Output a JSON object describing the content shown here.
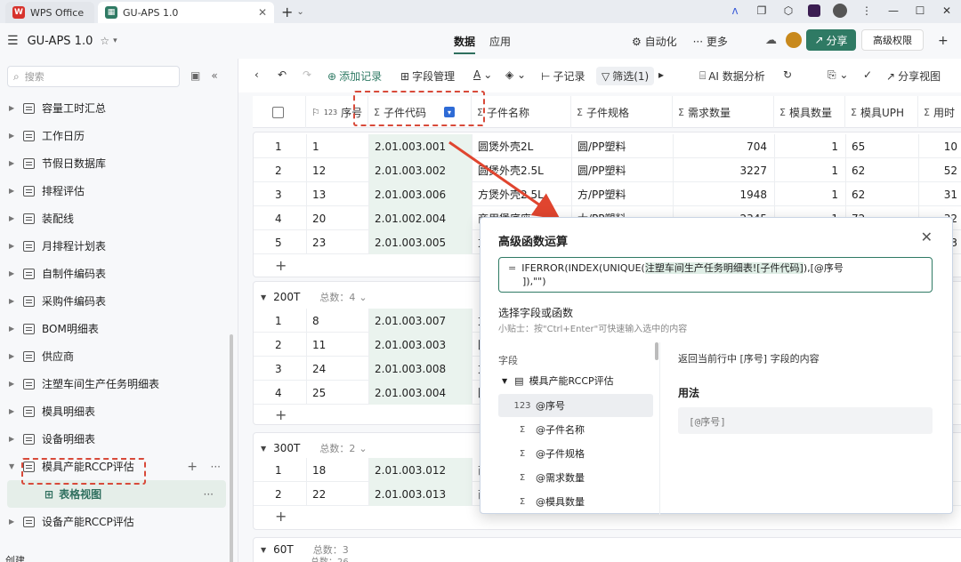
{
  "tabs": [
    {
      "label": "WPS Office",
      "color": "#d7322c"
    },
    {
      "label": "GU-APS 1.0",
      "color": "#2f7a64"
    }
  ],
  "app": {
    "title": "GU-APS 1.0",
    "center_tabs": [
      "数据",
      "应用"
    ],
    "automation": "自动化",
    "more": "更多",
    "share": "分享",
    "permission": "高级权限"
  },
  "sidebar": {
    "search_placeholder": "搜索",
    "items": [
      "容量工时汇总",
      "工作日历",
      "节假日数据库",
      "排程评估",
      "装配线",
      "月排程计划表",
      "自制件编码表",
      "采购件编码表",
      "BOM明细表",
      "供应商",
      "注塑车间生产任务明细表",
      "模具明细表",
      "设备明细表",
      "模具产能RCCP评估"
    ],
    "sub_view": "表格视图",
    "last_item": "设备产能RCCP评估",
    "footer": "创建"
  },
  "toolbar": {
    "add_record": "添加记录",
    "field_manage": "字段管理",
    "sub_record": "子记录",
    "filter": "筛选(1)",
    "ai": "AI 数据分析",
    "share_view": "分享视图"
  },
  "columns": [
    {
      "label": "序号",
      "prefix": "123"
    },
    {
      "label": "子件代码",
      "prefix": "Σ"
    },
    {
      "label": "子件名称",
      "prefix": "Σ"
    },
    {
      "label": "子件规格",
      "prefix": "Σ"
    },
    {
      "label": "需求数量",
      "prefix": "Σ"
    },
    {
      "label": "模具数量",
      "prefix": "Σ"
    },
    {
      "label": "模具UPH",
      "prefix": "Σ"
    },
    {
      "label": "用时",
      "prefix": "Σ"
    }
  ],
  "groups": [
    {
      "rows": [
        {
          "n": "1",
          "seq": "1",
          "code": "2.01.003.001",
          "name": "圆煲外壳2L",
          "spec": "圆/PP塑料",
          "qty": "704",
          "molds": "1",
          "uph": "65",
          "time": "10"
        },
        {
          "n": "2",
          "seq": "12",
          "code": "2.01.003.002",
          "name": "圆煲外壳2.5L",
          "spec": "圆/PP塑料",
          "qty": "3227",
          "molds": "1",
          "uph": "62",
          "time": "52"
        },
        {
          "n": "3",
          "seq": "13",
          "code": "2.01.003.006",
          "name": "方煲外壳2.5L",
          "spec": "方/PP塑料",
          "qty": "1948",
          "molds": "1",
          "uph": "62",
          "time": "31"
        },
        {
          "n": "4",
          "seq": "20",
          "code": "2.01.002.004",
          "name": "商用煲底座",
          "spec": "大/PP塑料",
          "qty": "2345",
          "molds": "1",
          "uph": "72",
          "time": "32"
        },
        {
          "n": "5",
          "seq": "23",
          "code": "2.01.003.005",
          "name": "方",
          "spec": "",
          "qty": "",
          "molds": "",
          "uph": "",
          "time": "3"
        }
      ]
    },
    {
      "name": "200T",
      "count_label": "总数：4",
      "rows": [
        {
          "n": "1",
          "seq": "8",
          "code": "2.01.003.007",
          "name": "方"
        },
        {
          "n": "2",
          "seq": "11",
          "code": "2.01.003.003",
          "name": "圆"
        },
        {
          "n": "3",
          "seq": "24",
          "code": "2.01.003.008",
          "name": "方"
        },
        {
          "n": "4",
          "seq": "25",
          "code": "2.01.003.004",
          "name": "圆"
        }
      ]
    },
    {
      "name": "300T",
      "count_label": "总数：2",
      "rows": [
        {
          "n": "1",
          "seq": "18",
          "code": "2.01.003.012",
          "name": "商"
        },
        {
          "n": "2",
          "seq": "22",
          "code": "2.01.003.013",
          "name": "商"
        }
      ]
    },
    {
      "name": "60T",
      "count_label": "总数：3",
      "sub_count": "总数：26"
    }
  ],
  "dialog": {
    "title": "高级函数运算",
    "formula_eq": "=",
    "formula_part1": "IFERROR(INDEX(UNIQUE(",
    "formula_ref": "注塑车间生产任务明细表![子件代码]",
    "formula_part2": "),[@序号",
    "formula_line2": "]),\"\")",
    "select_label": "选择字段或函数",
    "tip": "小贴士：按\"Ctrl+Enter\"可快速输入选中的内容",
    "section_fields": "字段",
    "table_name": "模具产能RCCP评估",
    "fields": [
      {
        "kind": "123",
        "label": "@序号"
      },
      {
        "kind": "Σ",
        "label": "@子件名称"
      },
      {
        "kind": "Σ",
        "label": "@子件规格"
      },
      {
        "kind": "Σ",
        "label": "@需求数量"
      },
      {
        "kind": "Σ",
        "label": "@模具数量"
      }
    ],
    "description": "返回当前行中 [序号] 字段的内容",
    "usage_label": "用法",
    "usage_code": "[@序号]"
  }
}
